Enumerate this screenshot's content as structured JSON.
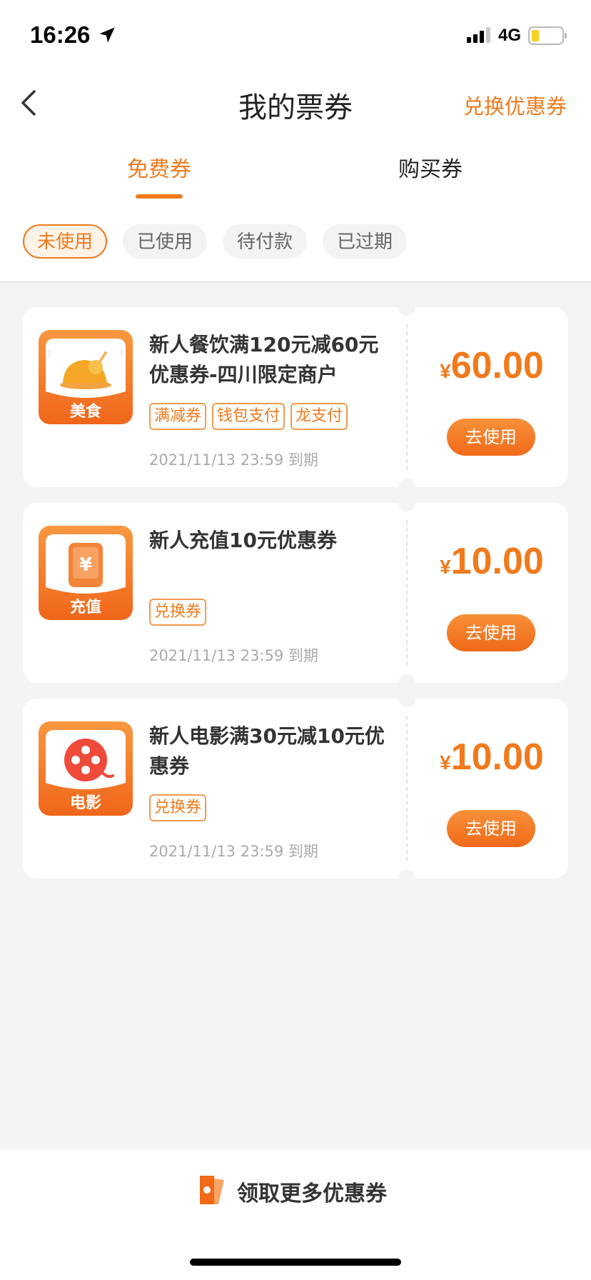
{
  "status_bar": {
    "time": "16:26",
    "network": "4G"
  },
  "nav": {
    "title": "我的票券",
    "action": "兑换优惠券"
  },
  "main_tabs": [
    {
      "label": "免费券",
      "active": true
    },
    {
      "label": "购买券",
      "active": false
    }
  ],
  "filters": [
    {
      "label": "未使用",
      "active": true
    },
    {
      "label": "已使用",
      "active": false
    },
    {
      "label": "待付款",
      "active": false
    },
    {
      "label": "已过期",
      "active": false
    }
  ],
  "coupons": [
    {
      "icon": "food-icon",
      "icon_label": "美食",
      "title_line1": "新人餐饮满120元减60元",
      "title_line2": "优惠券-四川限定商户",
      "tags": [
        "满减券",
        "钱包支付",
        "龙支付"
      ],
      "expiry": "2021/11/13 23:59 到期",
      "currency": "¥",
      "amount": "60.00",
      "button": "去使用"
    },
    {
      "icon": "recharge-icon",
      "icon_label": "充值",
      "title_line1": "新人充值10元优惠券",
      "title_line2": "",
      "tags": [
        "兑换券"
      ],
      "expiry": "2021/11/13 23:59 到期",
      "currency": "¥",
      "amount": "10.00",
      "button": "去使用"
    },
    {
      "icon": "movie-icon",
      "icon_label": "电影",
      "title_line1": "新人电影满30元减10元优",
      "title_line2": "惠券",
      "tags": [
        "兑换券"
      ],
      "expiry": "2021/11/13 23:59 到期",
      "currency": "¥",
      "amount": "10.00",
      "button": "去使用"
    }
  ],
  "bottom": {
    "label": "领取更多优惠券"
  },
  "colors": {
    "accent": "#f07a1c",
    "background": "#f4f4f4"
  }
}
